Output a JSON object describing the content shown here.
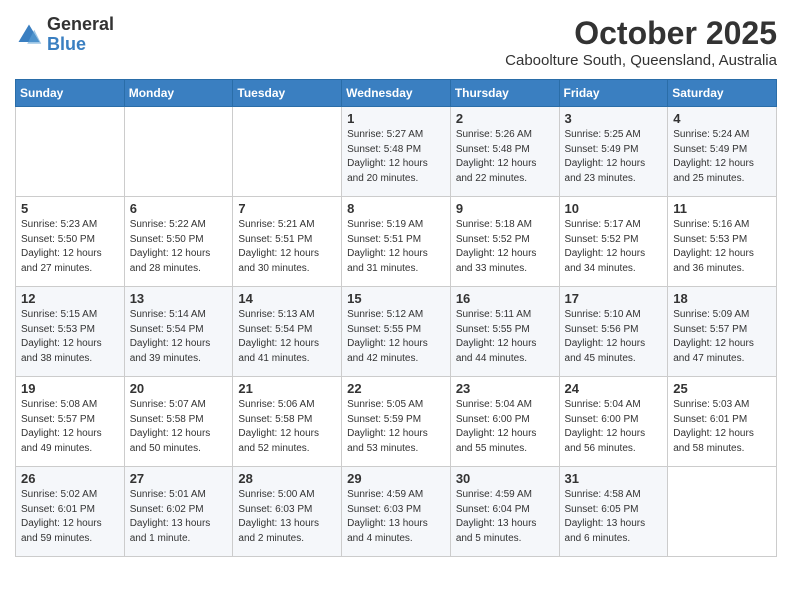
{
  "header": {
    "logo_general": "General",
    "logo_blue": "Blue",
    "month": "October 2025",
    "location": "Caboolture South, Queensland, Australia"
  },
  "days_of_week": [
    "Sunday",
    "Monday",
    "Tuesday",
    "Wednesday",
    "Thursday",
    "Friday",
    "Saturday"
  ],
  "weeks": [
    [
      {
        "day": "",
        "info": ""
      },
      {
        "day": "",
        "info": ""
      },
      {
        "day": "",
        "info": ""
      },
      {
        "day": "1",
        "info": "Sunrise: 5:27 AM\nSunset: 5:48 PM\nDaylight: 12 hours\nand 20 minutes."
      },
      {
        "day": "2",
        "info": "Sunrise: 5:26 AM\nSunset: 5:48 PM\nDaylight: 12 hours\nand 22 minutes."
      },
      {
        "day": "3",
        "info": "Sunrise: 5:25 AM\nSunset: 5:49 PM\nDaylight: 12 hours\nand 23 minutes."
      },
      {
        "day": "4",
        "info": "Sunrise: 5:24 AM\nSunset: 5:49 PM\nDaylight: 12 hours\nand 25 minutes."
      }
    ],
    [
      {
        "day": "5",
        "info": "Sunrise: 5:23 AM\nSunset: 5:50 PM\nDaylight: 12 hours\nand 27 minutes."
      },
      {
        "day": "6",
        "info": "Sunrise: 5:22 AM\nSunset: 5:50 PM\nDaylight: 12 hours\nand 28 minutes."
      },
      {
        "day": "7",
        "info": "Sunrise: 5:21 AM\nSunset: 5:51 PM\nDaylight: 12 hours\nand 30 minutes."
      },
      {
        "day": "8",
        "info": "Sunrise: 5:19 AM\nSunset: 5:51 PM\nDaylight: 12 hours\nand 31 minutes."
      },
      {
        "day": "9",
        "info": "Sunrise: 5:18 AM\nSunset: 5:52 PM\nDaylight: 12 hours\nand 33 minutes."
      },
      {
        "day": "10",
        "info": "Sunrise: 5:17 AM\nSunset: 5:52 PM\nDaylight: 12 hours\nand 34 minutes."
      },
      {
        "day": "11",
        "info": "Sunrise: 5:16 AM\nSunset: 5:53 PM\nDaylight: 12 hours\nand 36 minutes."
      }
    ],
    [
      {
        "day": "12",
        "info": "Sunrise: 5:15 AM\nSunset: 5:53 PM\nDaylight: 12 hours\nand 38 minutes."
      },
      {
        "day": "13",
        "info": "Sunrise: 5:14 AM\nSunset: 5:54 PM\nDaylight: 12 hours\nand 39 minutes."
      },
      {
        "day": "14",
        "info": "Sunrise: 5:13 AM\nSunset: 5:54 PM\nDaylight: 12 hours\nand 41 minutes."
      },
      {
        "day": "15",
        "info": "Sunrise: 5:12 AM\nSunset: 5:55 PM\nDaylight: 12 hours\nand 42 minutes."
      },
      {
        "day": "16",
        "info": "Sunrise: 5:11 AM\nSunset: 5:55 PM\nDaylight: 12 hours\nand 44 minutes."
      },
      {
        "day": "17",
        "info": "Sunrise: 5:10 AM\nSunset: 5:56 PM\nDaylight: 12 hours\nand 45 minutes."
      },
      {
        "day": "18",
        "info": "Sunrise: 5:09 AM\nSunset: 5:57 PM\nDaylight: 12 hours\nand 47 minutes."
      }
    ],
    [
      {
        "day": "19",
        "info": "Sunrise: 5:08 AM\nSunset: 5:57 PM\nDaylight: 12 hours\nand 49 minutes."
      },
      {
        "day": "20",
        "info": "Sunrise: 5:07 AM\nSunset: 5:58 PM\nDaylight: 12 hours\nand 50 minutes."
      },
      {
        "day": "21",
        "info": "Sunrise: 5:06 AM\nSunset: 5:58 PM\nDaylight: 12 hours\nand 52 minutes."
      },
      {
        "day": "22",
        "info": "Sunrise: 5:05 AM\nSunset: 5:59 PM\nDaylight: 12 hours\nand 53 minutes."
      },
      {
        "day": "23",
        "info": "Sunrise: 5:04 AM\nSunset: 6:00 PM\nDaylight: 12 hours\nand 55 minutes."
      },
      {
        "day": "24",
        "info": "Sunrise: 5:04 AM\nSunset: 6:00 PM\nDaylight: 12 hours\nand 56 minutes."
      },
      {
        "day": "25",
        "info": "Sunrise: 5:03 AM\nSunset: 6:01 PM\nDaylight: 12 hours\nand 58 minutes."
      }
    ],
    [
      {
        "day": "26",
        "info": "Sunrise: 5:02 AM\nSunset: 6:01 PM\nDaylight: 12 hours\nand 59 minutes."
      },
      {
        "day": "27",
        "info": "Sunrise: 5:01 AM\nSunset: 6:02 PM\nDaylight: 13 hours\nand 1 minute."
      },
      {
        "day": "28",
        "info": "Sunrise: 5:00 AM\nSunset: 6:03 PM\nDaylight: 13 hours\nand 2 minutes."
      },
      {
        "day": "29",
        "info": "Sunrise: 4:59 AM\nSunset: 6:03 PM\nDaylight: 13 hours\nand 4 minutes."
      },
      {
        "day": "30",
        "info": "Sunrise: 4:59 AM\nSunset: 6:04 PM\nDaylight: 13 hours\nand 5 minutes."
      },
      {
        "day": "31",
        "info": "Sunrise: 4:58 AM\nSunset: 6:05 PM\nDaylight: 13 hours\nand 6 minutes."
      },
      {
        "day": "",
        "info": ""
      }
    ]
  ]
}
